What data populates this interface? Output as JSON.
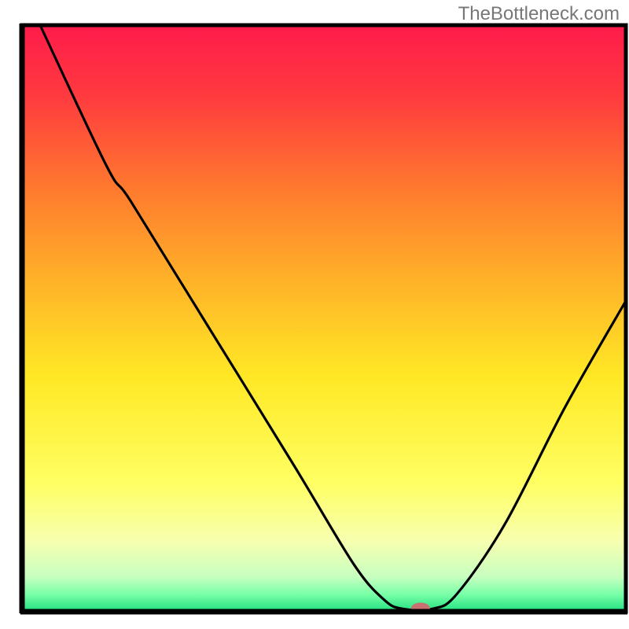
{
  "watermark": "TheBottleneck.com",
  "chart_data": {
    "type": "line",
    "title": "",
    "xlabel": "",
    "ylabel": "",
    "xlim": [
      0,
      100
    ],
    "ylim": [
      0,
      100
    ],
    "grid": false,
    "background": {
      "type": "vertical-gradient",
      "stops": [
        {
          "offset": 0.0,
          "color": "#ff1b4b"
        },
        {
          "offset": 0.12,
          "color": "#ff3a3f"
        },
        {
          "offset": 0.28,
          "color": "#ff7a2e"
        },
        {
          "offset": 0.45,
          "color": "#ffb728"
        },
        {
          "offset": 0.6,
          "color": "#ffe825"
        },
        {
          "offset": 0.78,
          "color": "#ffff63"
        },
        {
          "offset": 0.88,
          "color": "#f7ffb0"
        },
        {
          "offset": 0.94,
          "color": "#c8ffc0"
        },
        {
          "offset": 0.97,
          "color": "#7affa8"
        },
        {
          "offset": 1.0,
          "color": "#1fe07f"
        }
      ]
    },
    "series": [
      {
        "name": "bottleneck-curve",
        "color": "#000000",
        "points": [
          {
            "x": 3.0,
            "y": 100.0
          },
          {
            "x": 14.0,
            "y": 76.0
          },
          {
            "x": 18.0,
            "y": 70.0
          },
          {
            "x": 30.0,
            "y": 50.0
          },
          {
            "x": 45.0,
            "y": 25.0
          },
          {
            "x": 55.0,
            "y": 8.0
          },
          {
            "x": 60.0,
            "y": 2.0
          },
          {
            "x": 63.0,
            "y": 0.5
          },
          {
            "x": 68.0,
            "y": 0.5
          },
          {
            "x": 72.0,
            "y": 3.0
          },
          {
            "x": 80.0,
            "y": 15.0
          },
          {
            "x": 90.0,
            "y": 35.0
          },
          {
            "x": 100.0,
            "y": 53.0
          }
        ]
      }
    ],
    "marker": {
      "name": "optimal-point",
      "x": 66.0,
      "y": 0.6,
      "color": "#c97070",
      "rx": 12,
      "ry": 7
    },
    "frame": {
      "color": "#000000",
      "strokeWidth": 5
    }
  }
}
